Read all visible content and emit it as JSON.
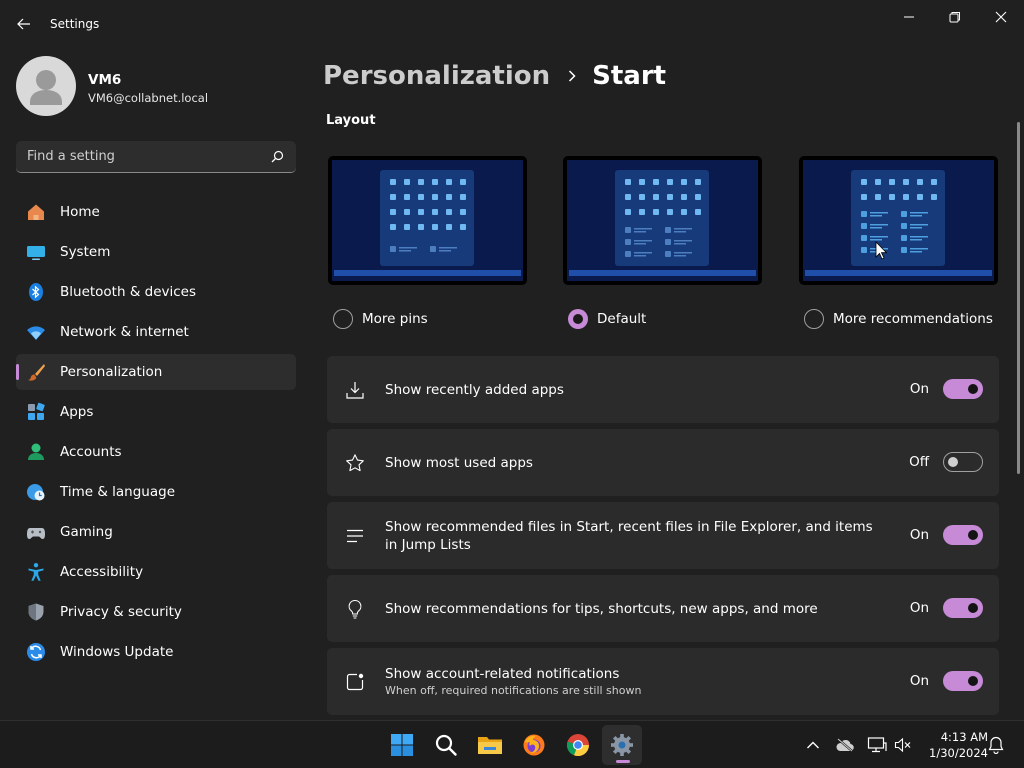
{
  "window": {
    "title": "Settings"
  },
  "user": {
    "name": "VM6",
    "email": "VM6@collabnet.local"
  },
  "search": {
    "placeholder": "Find a setting"
  },
  "nav": [
    {
      "label": "Home",
      "icon": "home-icon"
    },
    {
      "label": "System",
      "icon": "system-icon"
    },
    {
      "label": "Bluetooth & devices",
      "icon": "bluetooth-icon"
    },
    {
      "label": "Network & internet",
      "icon": "wifi-icon"
    },
    {
      "label": "Personalization",
      "icon": "paintbrush-icon",
      "selected": true
    },
    {
      "label": "Apps",
      "icon": "apps-icon"
    },
    {
      "label": "Accounts",
      "icon": "accounts-icon"
    },
    {
      "label": "Time & language",
      "icon": "clock-globe-icon"
    },
    {
      "label": "Gaming",
      "icon": "gamepad-icon"
    },
    {
      "label": "Accessibility",
      "icon": "accessibility-icon"
    },
    {
      "label": "Privacy & security",
      "icon": "shield-icon"
    },
    {
      "label": "Windows Update",
      "icon": "update-icon"
    }
  ],
  "breadcrumb": {
    "parent": "Personalization",
    "current": "Start"
  },
  "layout": {
    "heading": "Layout",
    "options": [
      {
        "label": "More pins",
        "selected": false
      },
      {
        "label": "Default",
        "selected": true
      },
      {
        "label": "More recommendations",
        "selected": false
      }
    ]
  },
  "settings": [
    {
      "title": "Show recently added apps",
      "state": "On",
      "icon": "download-icon"
    },
    {
      "title": "Show most used apps",
      "state": "Off",
      "icon": "star-icon"
    },
    {
      "title": "Show recommended files in Start, recent files in File Explorer, and items in Jump Lists",
      "state": "On",
      "icon": "list-lines-icon"
    },
    {
      "title": "Show recommendations for tips, shortcuts, new apps, and more",
      "state": "On",
      "icon": "lightbulb-icon"
    },
    {
      "title": "Show account-related notifications",
      "subtitle": "When off, required notifications are still shown",
      "state": "On",
      "icon": "notification-badge-icon"
    }
  ],
  "taskbar": {
    "apps": [
      "windows-start-icon",
      "search-icon",
      "file-explorer-icon",
      "firefox-icon",
      "chrome-icon",
      "settings-gear-icon"
    ],
    "active_app": "settings-gear-icon",
    "tray": [
      "chevron-up-icon",
      "cloud-offline-icon",
      "network-icon",
      "speaker-muted-icon",
      "notification-bell-icon"
    ],
    "time": "4:13 AM",
    "date": "1/30/2024"
  },
  "colors": {
    "accent": "#c78ad6",
    "background": "#202020",
    "card": "#2b2b2b",
    "taskbar": "#1c1c1c"
  }
}
